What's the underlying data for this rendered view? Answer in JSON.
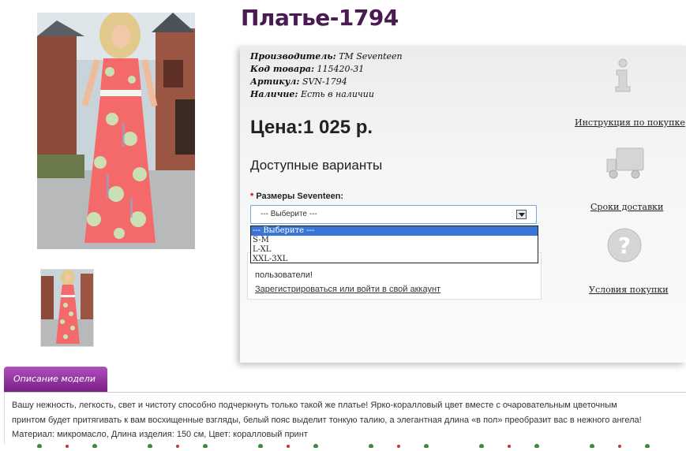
{
  "product": {
    "title": "Платье-1794",
    "specs": [
      {
        "label": "Производитель:",
        "value": "TM Seventeen"
      },
      {
        "label": "Код товара:",
        "value": "115420-31"
      },
      {
        "label": "Артикул:",
        "value": "SVN-1794"
      },
      {
        "label": "Наличие:",
        "value": "Есть в наличии"
      }
    ],
    "price": "Цена:1 025 р.",
    "variants_heading": "Доступные варианты",
    "size_required_mark": "*",
    "size_label": "Размеры Seventeen:",
    "size_select_value": "--- Выберите ---",
    "size_options": [
      "--- Выберите ---",
      "S-M",
      "L-XL",
      "XXL-3XL"
    ],
    "notice_text": "пользователи!",
    "notice_link": "Зарегистрироваться или войти в свой аккаунт"
  },
  "sidebar": {
    "links": [
      {
        "label": "Инструкция по покупке",
        "icon": "info-icon"
      },
      {
        "label": "Сроки доставки",
        "icon": "truck-icon"
      },
      {
        "label": "Условия покупки",
        "icon": "question-icon"
      }
    ]
  },
  "description": {
    "tab_label": "Описание модели",
    "lines": [
      "Вашу нежность, легкость, свет и чистоту способно подчеркнуть только такой же платье! Ярко-коралловый цвет вместе с очаровательным цветочным",
      "принтом будет притягивать к вам восхищенные взгляды, белый пояс выделит тонкую талию, а элегантная длина «в пол» преобразит вас в нежного ангела!",
      "Материал: микромасло, Длина изделия: 150 см, Цвет: коралловый принт"
    ]
  },
  "colors": {
    "title": "#4a1a52",
    "tab": "#8e2a9c",
    "dress": "#f46a6a",
    "selected_option": "#3875d7"
  }
}
